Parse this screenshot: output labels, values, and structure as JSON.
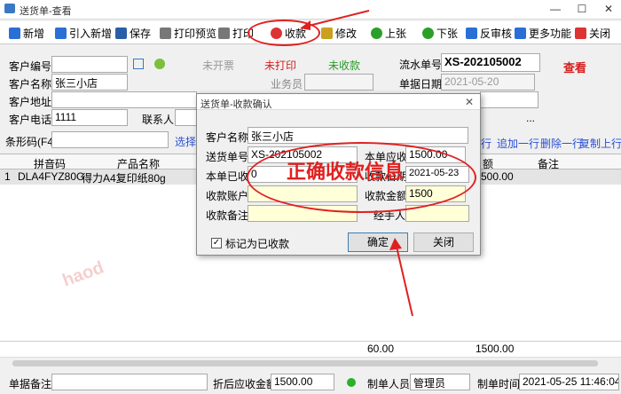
{
  "window": {
    "title": "送货单-查看",
    "minimize": "—",
    "maximize": "☐",
    "close": "✕"
  },
  "toolbar": [
    {
      "label": "新增",
      "icon": "plus-icon",
      "color": "#2a6fd6"
    },
    {
      "label": "引入新增",
      "icon": "plus-icon",
      "color": "#2a6fd6"
    },
    {
      "label": "保存",
      "icon": "save-icon",
      "color": "#2a5fa8"
    },
    {
      "label": "打印预览",
      "icon": "print-preview-icon",
      "color": "#777"
    },
    {
      "label": "打印",
      "icon": "print-icon",
      "color": "#777"
    },
    {
      "label": "收款",
      "icon": "payment-icon",
      "color": "#d33"
    },
    {
      "label": "修改",
      "icon": "edit-icon",
      "color": "#c9a020"
    },
    {
      "label": "上张",
      "icon": "prev-icon",
      "color": "#2aa02a"
    },
    {
      "label": "下张",
      "icon": "next-icon",
      "color": "#2aa02a"
    },
    {
      "label": "反审核",
      "icon": "unaudit-icon",
      "color": "#2a6fd6"
    },
    {
      "label": "更多功能",
      "icon": "more-icon",
      "color": "#2a6fd6"
    },
    {
      "label": "关闭",
      "icon": "close-icon",
      "color": "#d33"
    }
  ],
  "form": {
    "customer_no_label": "客户编号",
    "customer_no": "",
    "customer_name_label": "客户名称",
    "customer_name": "张三小店",
    "customer_addr_label": "客户地址",
    "customer_addr": "",
    "customer_phone_label": "客户电话",
    "customer_phone": "1111",
    "contact_label": "联系人",
    "status_invoice": "未开票",
    "status_print": "未打印",
    "status_paid": "未收款",
    "salesman_label": "业务员",
    "serial_label": "流水单号",
    "serial": "XS-202105002",
    "date_label": "单据日期",
    "date": "2021-05-20",
    "view_label": "查看",
    "barcode_label": "条形码(F4)",
    "select_link": "选择+",
    "more_dots": "..."
  },
  "row_actions": [
    "行",
    "追加一行",
    "删除一行",
    "复制上行"
  ],
  "grid": {
    "headers": [
      "拼音码",
      "产品名称",
      "额",
      "备注"
    ],
    "rows": [
      {
        "idx": "1",
        "pinyin": "DLA4FYZ80G",
        "name": "得力A4复印纸80g",
        "amount": "500.00"
      }
    ],
    "sum_qty": "60.00",
    "sum_amount": "1500.00"
  },
  "footer": {
    "remark_label": "单据备注",
    "remark": "",
    "receivable_label": "折后应收金额",
    "receivable": "1500.00",
    "maker_label": "制单人员",
    "maker": "管理员",
    "time_label": "制单时间",
    "time": "2021-05-25 11:46:04"
  },
  "dialog": {
    "title": "送货单-收款确认",
    "customer_label": "客户名称",
    "customer": "张三小店",
    "order_label": "送货单号",
    "order": "XS-202105002",
    "due_label": "本单应收",
    "due": "1500.00",
    "paid_label": "本单已收",
    "paid": "0",
    "date_label": "收款日期",
    "date": "2021-05-23",
    "account_label": "收款账户",
    "account": "",
    "amount_label": "收款金额",
    "amount": "1500",
    "remark_label": "收款备注",
    "remark": "",
    "handler_label": "经手人",
    "handler": "",
    "mark_paid": "标记为已收款",
    "ok": "确定",
    "close": "关闭",
    "annotation": "正确收款信息"
  },
  "watermark": "haod",
  "accent_red": "#e02020"
}
